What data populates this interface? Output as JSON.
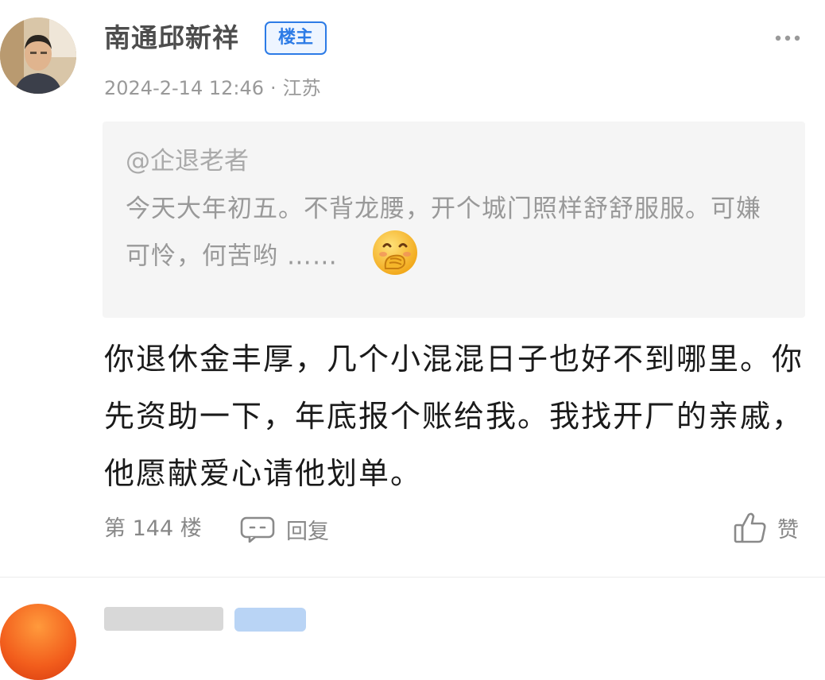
{
  "post": {
    "username": "南通邱新祥",
    "badge": "楼主",
    "timestamp": "2024-2-14 12:46",
    "separator": "·",
    "location": "江苏",
    "more_icon": "more-dots-icon"
  },
  "quote": {
    "author": "@企退老者",
    "text": "今天大年初五。不背龙腰，开个城门照样舒舒服服。可嫌可怜，何苦哟 ……",
    "emoji": "face-with-hand-over-mouth-emoji"
  },
  "content": {
    "text": "你退休金丰厚，几个小混混日子也好不到哪里。你先资助一下，年底报个账给我。我找开厂的亲戚，他愿献爱心请他划单。"
  },
  "footer": {
    "floor_label": "第 144 楼",
    "reply_label": "回复",
    "reply_icon": "comment-bubble-icon",
    "like_label": "赞",
    "like_icon": "thumbs-up-icon"
  },
  "colors": {
    "badge_blue": "#2c7be6",
    "quote_bg": "#f5f5f5",
    "meta_gray": "#999999"
  }
}
